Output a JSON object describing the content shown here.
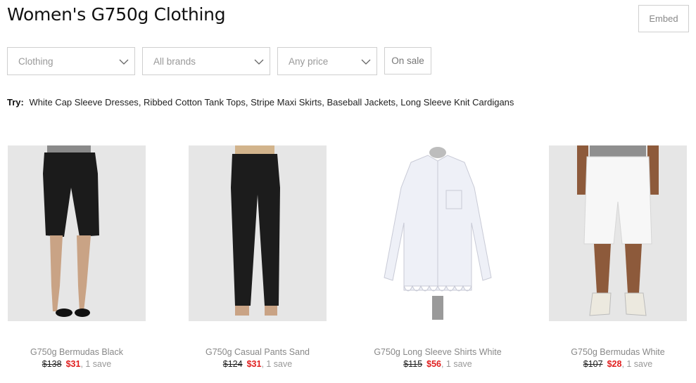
{
  "page": {
    "title": "Women's G750g Clothing",
    "embed_label": "Embed"
  },
  "filters": {
    "category": "Clothing",
    "brand": "All brands",
    "price": "Any price",
    "sale_label": "On sale"
  },
  "try": {
    "label": "Try:",
    "links": [
      "White Cap Sleeve Dresses",
      "Ribbed Cotton Tank Tops",
      "Stripe Maxi Skirts",
      "Baseball Jackets",
      "Long Sleeve Knit Cardigans"
    ]
  },
  "products": [
    {
      "name": "G750g Bermudas Black",
      "old_price": "$138",
      "new_price": "$31",
      "saves": ", 1 save"
    },
    {
      "name": "G750g Casual Pants Sand",
      "old_price": "$124",
      "new_price": "$31",
      "saves": ", 1 save"
    },
    {
      "name": "G750g Long Sleeve Shirts White",
      "old_price": "$115",
      "new_price": "$56",
      "saves": ", 1 save"
    },
    {
      "name": "G750g Bermudas White",
      "old_price": "$107",
      "new_price": "$28",
      "saves": ", 1 save"
    }
  ],
  "colors": {
    "sale_price": "#e02020",
    "image_bg": "#e6e6e6",
    "border": "#cfcfcf"
  }
}
